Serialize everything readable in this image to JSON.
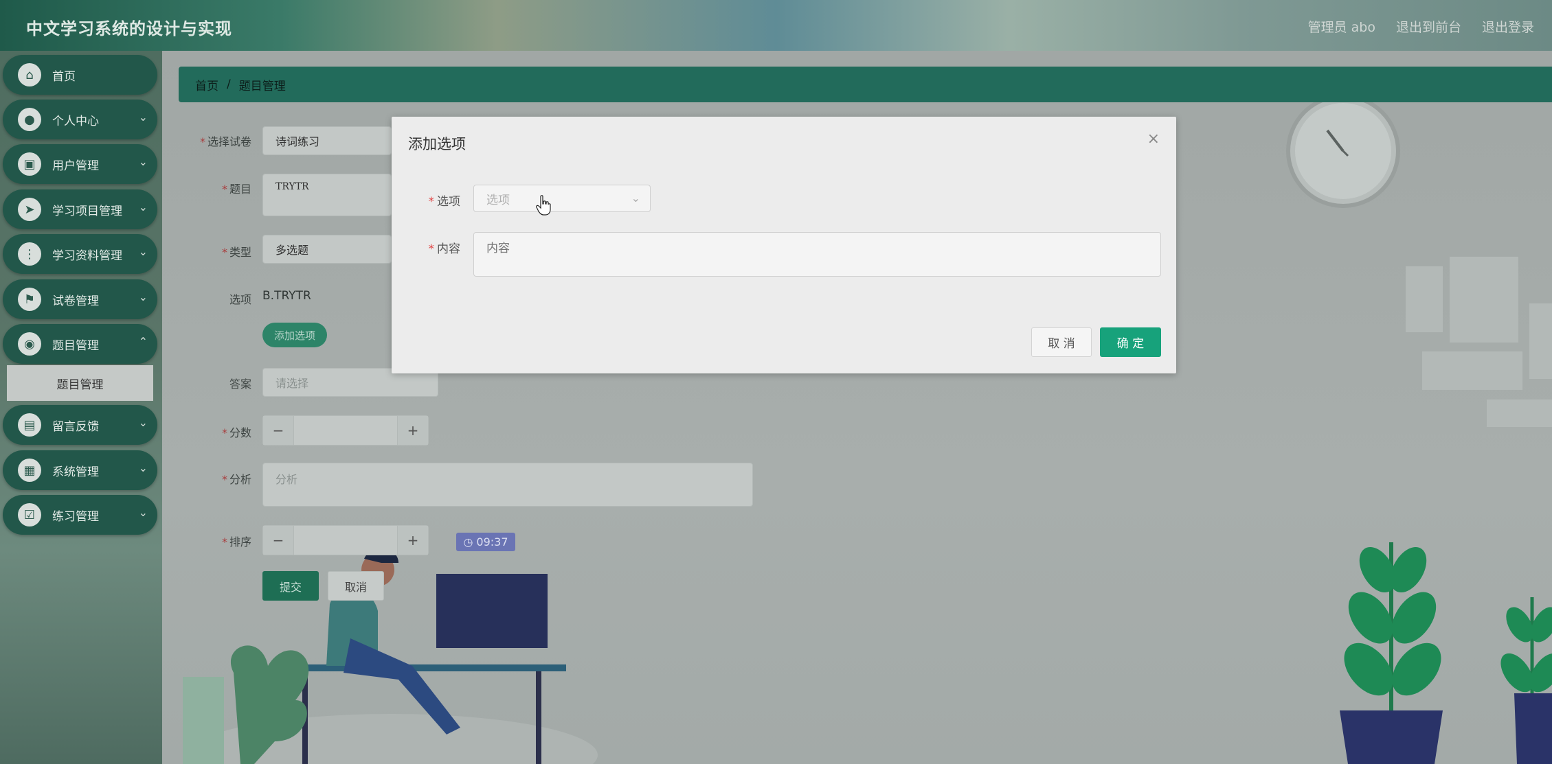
{
  "header": {
    "app_title": "中文学习系统的设计与实现",
    "links": [
      "管理员 abo",
      "退出到前台",
      "退出登录"
    ]
  },
  "sidebar": {
    "items": [
      {
        "label": "首页",
        "icon": "home-icon",
        "glyph": "⌂"
      },
      {
        "label": "个人中心",
        "icon": "user-icon",
        "glyph": "●"
      },
      {
        "label": "用户管理",
        "icon": "briefcase-icon",
        "glyph": "▣"
      },
      {
        "label": "学习项目管理",
        "icon": "send-icon",
        "glyph": "➤"
      },
      {
        "label": "学习资料管理",
        "icon": "grid-icon",
        "glyph": "⋮"
      },
      {
        "label": "试卷管理",
        "icon": "flag-icon",
        "glyph": "⚑"
      },
      {
        "label": "题目管理",
        "icon": "location-icon",
        "glyph": "◉"
      },
      {
        "label": "留言反馈",
        "icon": "wallet-icon",
        "glyph": "▤"
      },
      {
        "label": "系统管理",
        "icon": "apps-icon",
        "glyph": "▦"
      },
      {
        "label": "练习管理",
        "icon": "clipboard-icon",
        "glyph": "☑"
      }
    ],
    "submenu_active": "题目管理"
  },
  "breadcrumb": {
    "home": "首页",
    "separator": "/",
    "current": "题目管理"
  },
  "form": {
    "paper_label": "选择试卷",
    "paper_value": "诗词练习",
    "question_label": "题目",
    "question_value": "TRYTR",
    "type_label": "类型",
    "type_value": "多选题",
    "options_label": "选项",
    "options_value": "B.TRYTR",
    "add_option_label": "添加选项",
    "answer_label": "答案",
    "answer_placeholder": "请选择",
    "score_label": "分数",
    "analysis_label": "分析",
    "analysis_placeholder": "分析",
    "sort_label": "排序",
    "minus": "−",
    "plus": "+",
    "timer": "09:37",
    "submit_label": "提交",
    "cancel_label": "取消"
  },
  "modal": {
    "title": "添加选项",
    "close": "×",
    "option_label": "选项",
    "option_placeholder": "选项",
    "content_label": "内容",
    "content_placeholder": "内容",
    "cancel_label": "取 消",
    "ok_label": "确 定",
    "required_mark": "*"
  },
  "colors": {
    "primary": "#17a27b",
    "sidebar_item": "#22574a",
    "breadcrumb": "#226b5b"
  }
}
